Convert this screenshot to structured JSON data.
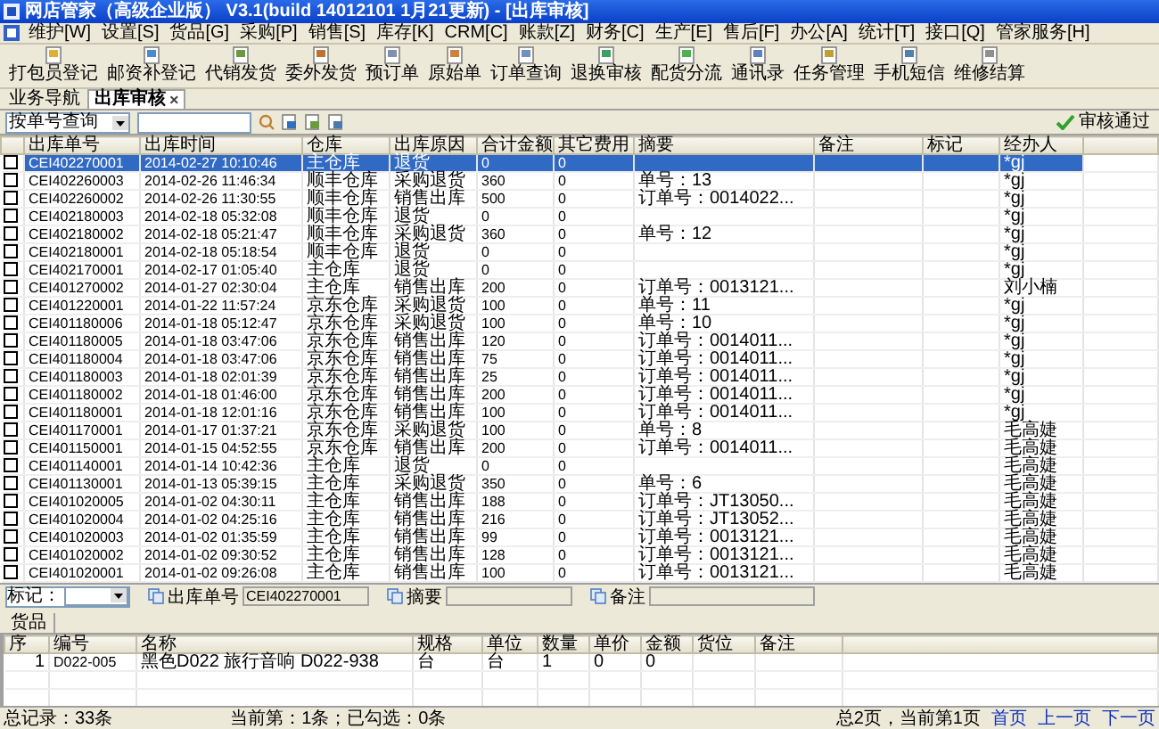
{
  "window": {
    "title": "网店管家（高级企业版） V3.1(build 14012101 1月21更新) - [出库审核]"
  },
  "menu": [
    "维护[W]",
    "设置[S]",
    "货品[G]",
    "采购[P]",
    "销售[S]",
    "库存[K]",
    "CRM[C]",
    "账款[Z]",
    "财务[C]",
    "生产[E]",
    "售后[F]",
    "办公[A]",
    "统计[T]",
    "接口[Q]",
    "管家服务[H]"
  ],
  "toolbar": [
    "打包员登记",
    "邮资补登记",
    "代销发货",
    "委外发货",
    "预订单",
    "原始单",
    "订单查询",
    "退换审核",
    "配货分流",
    "通讯录",
    "任务管理",
    "手机短信",
    "维修结算"
  ],
  "tabs": [
    {
      "label": "业务导航",
      "selected": false
    },
    {
      "label": "出库审核",
      "selected": true,
      "close": "×"
    }
  ],
  "search": {
    "mode": "按单号查询"
  },
  "approve_button": "审核通过",
  "table": {
    "columns": [
      "出库单号",
      "出库时间",
      "仓库",
      "出库原因",
      "合计金额",
      "其它费用",
      "摘要",
      "备注",
      "标记",
      "经办人"
    ],
    "rows": [
      {
        "selected": true,
        "checked": false,
        "cells": [
          "CEI402270001",
          "2014-02-27  10:10:46",
          "主仓库",
          "退货",
          "0",
          "0",
          "",
          "",
          "",
          "*gj"
        ]
      },
      {
        "selected": false,
        "checked": false,
        "cells": [
          "CEI402260003",
          "2014-02-26  11:46:34",
          "顺丰仓库",
          "采购退货",
          "360",
          "0",
          "单号：13",
          "",
          "",
          "*gj"
        ]
      },
      {
        "selected": false,
        "checked": false,
        "cells": [
          "CEI402260002",
          "2014-02-26  11:30:55",
          "顺丰仓库",
          "销售出库",
          "500",
          "0",
          "订单号：0014022...",
          "",
          "",
          "*gj"
        ]
      },
      {
        "selected": false,
        "checked": false,
        "cells": [
          "CEI402180003",
          "2014-02-18  05:32:08",
          "顺丰仓库",
          "退货",
          "0",
          "0",
          "",
          "",
          "",
          "*gj"
        ]
      },
      {
        "selected": false,
        "checked": false,
        "cells": [
          "CEI402180002",
          "2014-02-18  05:21:47",
          "顺丰仓库",
          "采购退货",
          "360",
          "0",
          "单号：12",
          "",
          "",
          "*gj"
        ]
      },
      {
        "selected": false,
        "checked": false,
        "cells": [
          "CEI402180001",
          "2014-02-18  05:18:54",
          "顺丰仓库",
          "退货",
          "0",
          "0",
          "",
          "",
          "",
          "*gj"
        ]
      },
      {
        "selected": false,
        "checked": false,
        "cells": [
          "CEI402170001",
          "2014-02-17  01:05:40",
          "主仓库",
          "退货",
          "0",
          "0",
          "",
          "",
          "",
          "*gj"
        ]
      },
      {
        "selected": false,
        "checked": false,
        "cells": [
          "CEI401270002",
          "2014-01-27  02:30:04",
          "主仓库",
          "销售出库",
          "200",
          "0",
          "订单号：0013121...",
          "",
          "",
          "刘小楠"
        ]
      },
      {
        "selected": false,
        "checked": false,
        "cells": [
          "CEI401220001",
          "2014-01-22  11:57:24",
          "京东仓库",
          "采购退货",
          "100",
          "0",
          "单号：11",
          "",
          "",
          "*gj"
        ]
      },
      {
        "selected": false,
        "checked": false,
        "cells": [
          "CEI401180006",
          "2014-01-18  05:12:47",
          "京东仓库",
          "采购退货",
          "100",
          "0",
          "单号：10",
          "",
          "",
          "*gj"
        ]
      },
      {
        "selected": false,
        "checked": false,
        "cells": [
          "CEI401180005",
          "2014-01-18  03:47:06",
          "京东仓库",
          "销售出库",
          "120",
          "0",
          "订单号：0014011...",
          "",
          "",
          "*gj"
        ]
      },
      {
        "selected": false,
        "checked": false,
        "cells": [
          "CEI401180004",
          "2014-01-18  03:47:06",
          "京东仓库",
          "销售出库",
          "75",
          "0",
          "订单号：0014011...",
          "",
          "",
          "*gj"
        ]
      },
      {
        "selected": false,
        "checked": false,
        "cells": [
          "CEI401180003",
          "2014-01-18  02:01:39",
          "京东仓库",
          "销售出库",
          "25",
          "0",
          "订单号：0014011...",
          "",
          "",
          "*gj"
        ]
      },
      {
        "selected": false,
        "checked": false,
        "cells": [
          "CEI401180002",
          "2014-01-18  01:46:00",
          "京东仓库",
          "销售出库",
          "200",
          "0",
          "订单号：0014011...",
          "",
          "",
          "*gj"
        ]
      },
      {
        "selected": false,
        "checked": false,
        "cells": [
          "CEI401180001",
          "2014-01-18  12:01:16",
          "京东仓库",
          "销售出库",
          "100",
          "0",
          "订单号：0014011...",
          "",
          "",
          "*gj"
        ]
      },
      {
        "selected": false,
        "checked": false,
        "cells": [
          "CEI401170001",
          "2014-01-17  01:37:21",
          "京东仓库",
          "采购退货",
          "100",
          "0",
          "单号：8",
          "",
          "",
          "毛高婕"
        ]
      },
      {
        "selected": false,
        "checked": false,
        "cells": [
          "CEI401150001",
          "2014-01-15  04:52:55",
          "京东仓库",
          "销售出库",
          "200",
          "0",
          "订单号：0014011...",
          "",
          "",
          "毛高婕"
        ]
      },
      {
        "selected": false,
        "checked": false,
        "cells": [
          "CEI401140001",
          "2014-01-14  10:42:36",
          "主仓库",
          "退货",
          "0",
          "0",
          "",
          "",
          "",
          "毛高婕"
        ]
      },
      {
        "selected": false,
        "checked": false,
        "cells": [
          "CEI401130001",
          "2014-01-13  05:39:15",
          "主仓库",
          "采购退货",
          "350",
          "0",
          "单号：6",
          "",
          "",
          "毛高婕"
        ]
      },
      {
        "selected": false,
        "checked": false,
        "cells": [
          "CEI401020005",
          "2014-01-02  04:30:11",
          "主仓库",
          "销售出库",
          "188",
          "0",
          "订单号：JT13050...",
          "",
          "",
          "毛高婕"
        ]
      },
      {
        "selected": false,
        "checked": false,
        "cells": [
          "CEI401020004",
          "2014-01-02  04:25:16",
          "主仓库",
          "销售出库",
          "216",
          "0",
          "订单号：JT13052...",
          "",
          "",
          "毛高婕"
        ]
      },
      {
        "selected": false,
        "checked": false,
        "cells": [
          "CEI401020003",
          "2014-01-02  01:35:59",
          "主仓库",
          "销售出库",
          "99",
          "0",
          "订单号：0013121...",
          "",
          "",
          "毛高婕"
        ]
      },
      {
        "selected": false,
        "checked": false,
        "cells": [
          "CEI401020002",
          "2014-01-02  09:30:52",
          "主仓库",
          "销售出库",
          "128",
          "0",
          "订单号：0013121...",
          "",
          "",
          "毛高婕"
        ]
      },
      {
        "selected": false,
        "checked": false,
        "cells": [
          "CEI401020001",
          "2014-01-02  09:26:08",
          "主仓库",
          "销售出库",
          "100",
          "0",
          "订单号：0013121...",
          "",
          "",
          "毛高婕"
        ]
      }
    ]
  },
  "detail_fields": [
    {
      "label": "标记：",
      "kind": "select"
    },
    {
      "label": "出库单号",
      "kind": "text",
      "value": "CEI402270001"
    },
    {
      "label": "摘要",
      "kind": "text"
    },
    {
      "label": "备注",
      "kind": "text"
    }
  ],
  "goods_tab": "货品",
  "goods": {
    "columns": [
      "序",
      "编号",
      "名称",
      "规格",
      "单位",
      "数量",
      "单价",
      "金额",
      "货位",
      "备注"
    ],
    "rows": [
      {
        "cells": [
          "1",
          "D022-005",
          "黑色D022 旅行音响 D022-938",
          "台",
          "台",
          "1",
          "0",
          "0",
          "",
          ""
        ]
      }
    ]
  },
  "status_bar": {
    "total": "总记录：33条",
    "current": "当前第：1条；已勾选：0条",
    "pages": "总2页，当前第1页",
    "links": [
      "首页",
      "上一页",
      "下一页"
    ]
  }
}
